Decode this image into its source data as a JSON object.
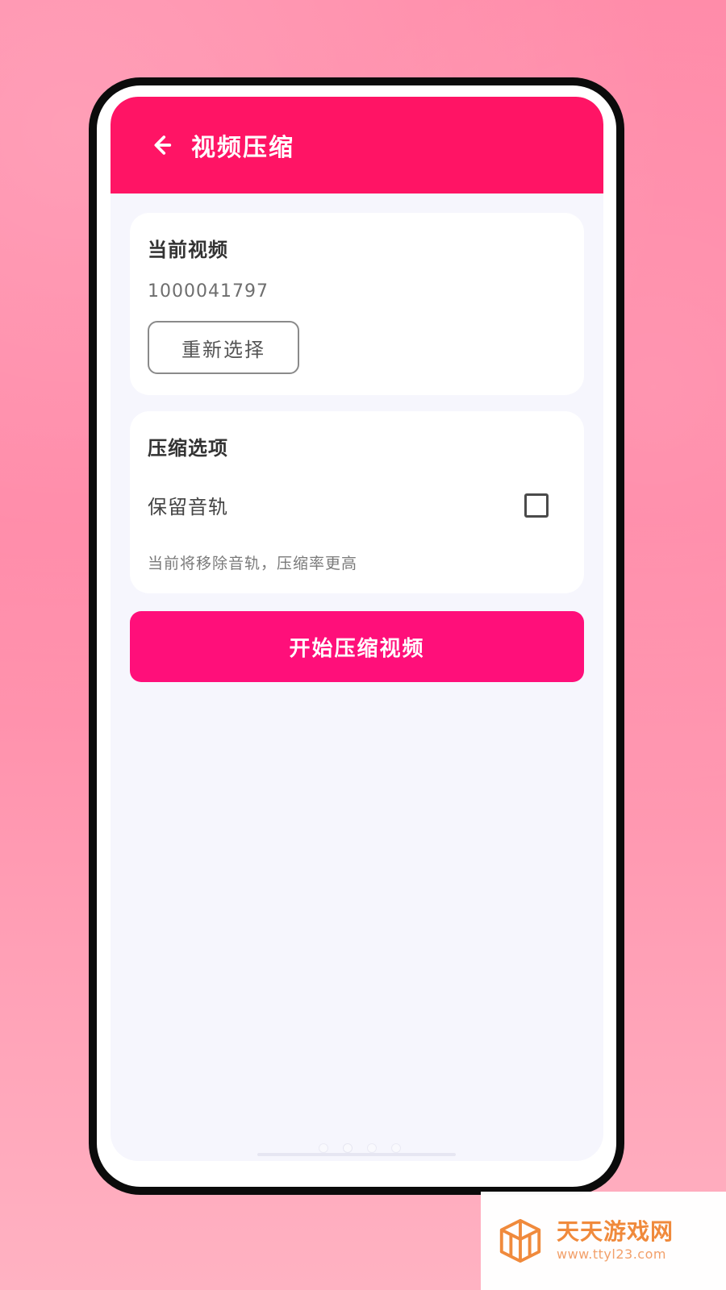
{
  "header": {
    "title": "视频压缩",
    "back_icon": "arrow-left-icon"
  },
  "current_video": {
    "section_title": "当前视频",
    "video_id": "1000041797",
    "reselect_label": "重新选择"
  },
  "compression_options": {
    "section_title": "压缩选项",
    "keep_audio_label": "保留音轨",
    "keep_audio_checked": false,
    "hint": "当前将移除音轨，压缩率更高"
  },
  "actions": {
    "start_label": "开始压缩视频"
  },
  "theme": {
    "header_color": "#ff1465",
    "primary_button_color": "#ff0f7a",
    "page_background": "#f6f6fd"
  },
  "watermark": {
    "title": "天天游戏网",
    "url": "www.ttyl23.com",
    "logo_icon": "box-logo-icon"
  }
}
